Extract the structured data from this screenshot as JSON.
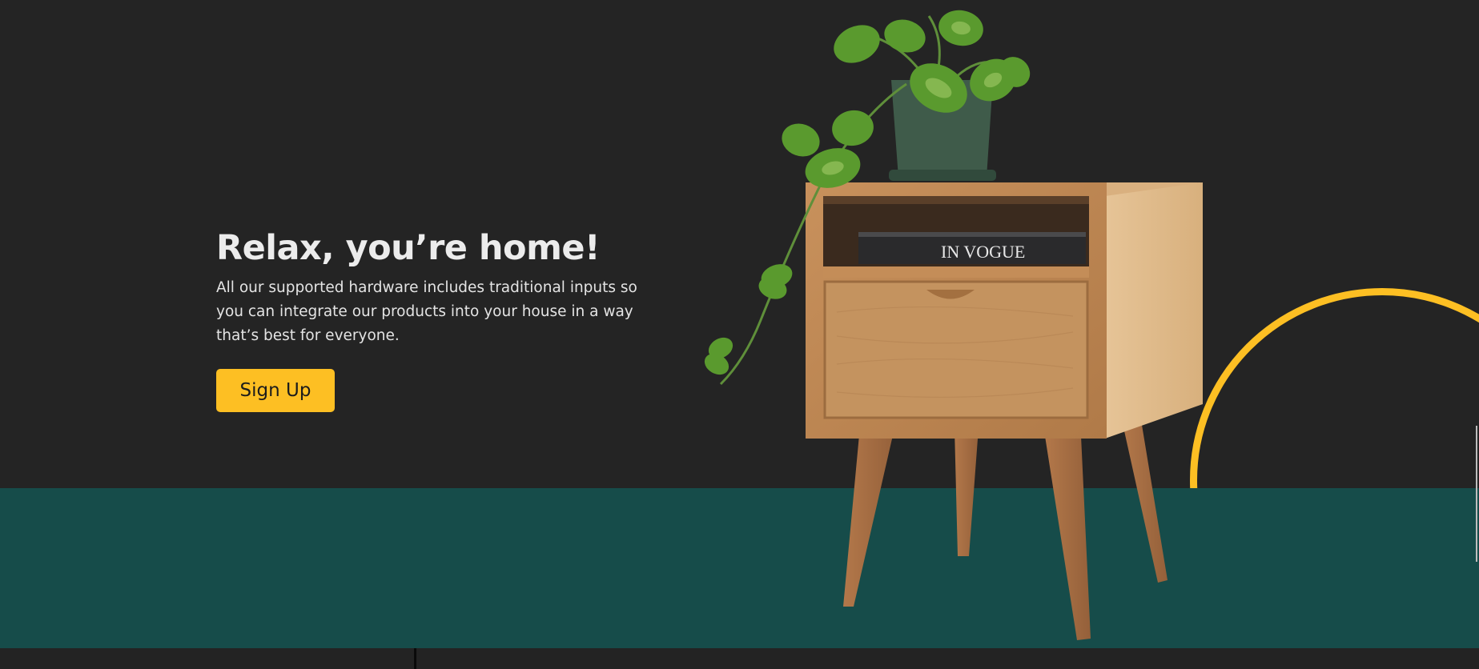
{
  "hero": {
    "title": "Relax, you’re home!",
    "description": "All our supported hardware includes traditional inputs so you can integrate our products into your house in a way that’s best for everyone.",
    "signup_label": "Sign Up",
    "book_spine_text": "IN VOGUE"
  },
  "colors": {
    "background": "#242424",
    "teal_band": "#164c4a",
    "accent": "#fdbf23",
    "text": "#ececec"
  },
  "images": {
    "product": "wooden-nightstand-with-plant"
  }
}
